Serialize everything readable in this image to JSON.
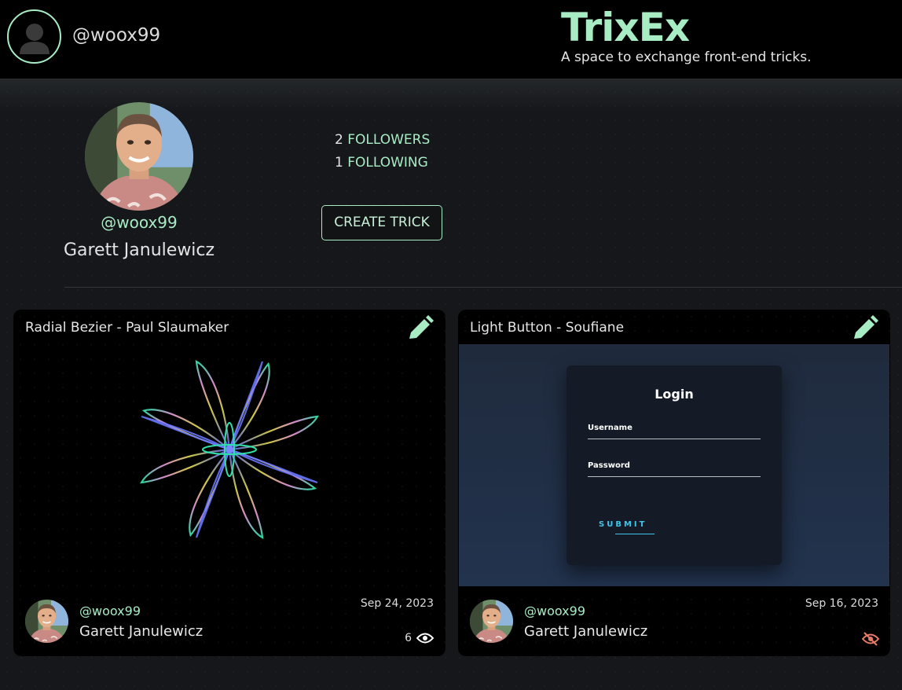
{
  "header": {
    "username": "@woox99",
    "brand_title": "TrixEx",
    "brand_subtitle": "A space to exchange front-end tricks."
  },
  "profile": {
    "handle": "@woox99",
    "full_name": "Garett Janulewicz",
    "followers_count": "2",
    "followers_label": "FOLLOWERS",
    "following_count": "1",
    "following_label": "FOLLOWING",
    "create_button": "CREATE TRICK"
  },
  "cards": [
    {
      "title": "Radial Bezier - Paul Slaumaker",
      "handle": "@woox99",
      "author": "Garett Janulewicz",
      "date": "Sep 24, 2023",
      "views": "6",
      "status_icon": "eye-icon"
    },
    {
      "title": "Light Button - Soufiane",
      "handle": "@woox99",
      "author": "Garett Janulewicz",
      "date": "Sep 16, 2023",
      "status_icon": "eye-slash-icon",
      "preview": {
        "login_title": "Login",
        "username_label": "Username",
        "password_label": "Password",
        "submit_label": "SUBMIT"
      }
    }
  ],
  "colors": {
    "accent": "#a8ecc4",
    "background": "#16171b",
    "hidden_icon": "#e97b6c"
  }
}
